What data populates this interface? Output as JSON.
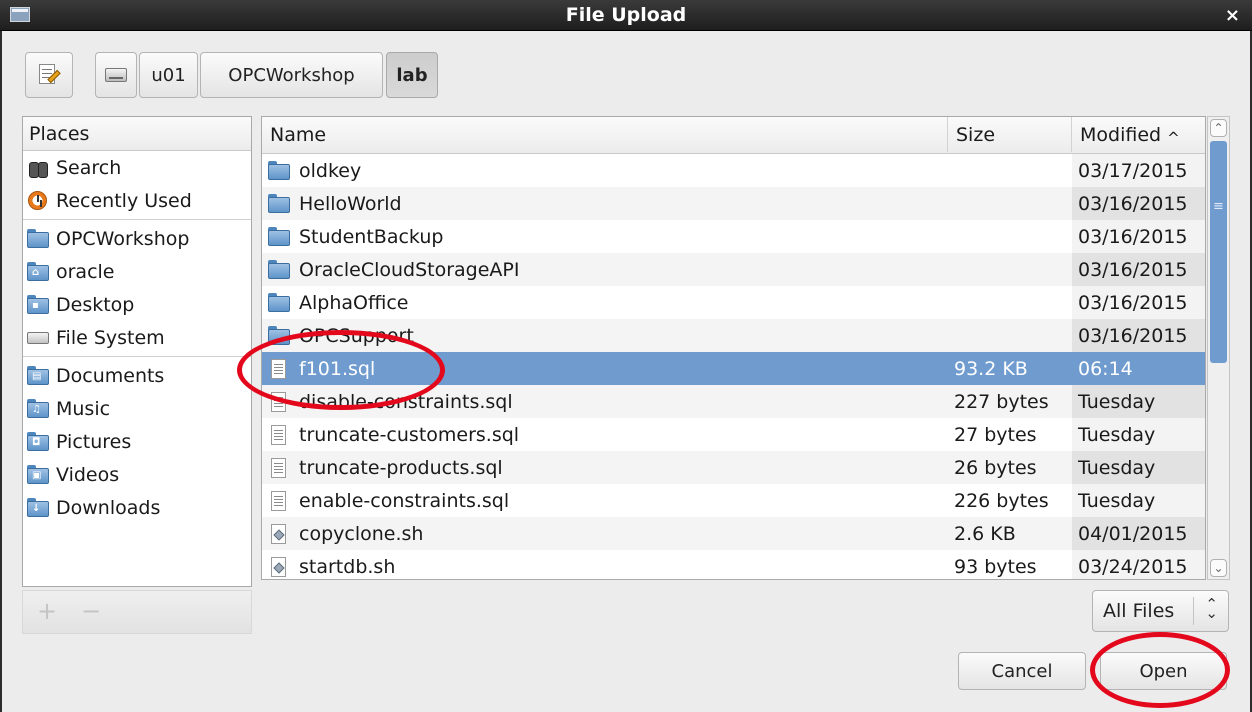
{
  "window": {
    "title": "File Upload",
    "close_glyph": "×"
  },
  "pathbar": {
    "segments": [
      {
        "label": "",
        "icon": "drive-icon",
        "active": false
      },
      {
        "label": "u01",
        "active": false
      },
      {
        "label": "OPCWorkshop",
        "active": false
      },
      {
        "label": "lab",
        "active": true
      }
    ]
  },
  "places": {
    "header": "Places",
    "groups": [
      [
        {
          "label": "Search",
          "icon": "binoculars-icon"
        },
        {
          "label": "Recently Used",
          "icon": "recent-clock-icon"
        }
      ],
      [
        {
          "label": "OPCWorkshop",
          "icon": "folder-icon"
        },
        {
          "label": "oracle",
          "icon": "home-folder-icon"
        },
        {
          "label": "Desktop",
          "icon": "desktop-folder-icon"
        },
        {
          "label": "File System",
          "icon": "drive-icon"
        }
      ],
      [
        {
          "label": "Documents",
          "icon": "documents-folder-icon"
        },
        {
          "label": "Music",
          "icon": "music-folder-icon"
        },
        {
          "label": "Pictures",
          "icon": "pictures-folder-icon"
        },
        {
          "label": "Videos",
          "icon": "videos-folder-icon"
        },
        {
          "label": "Downloads",
          "icon": "downloads-folder-icon"
        }
      ]
    ],
    "add_glyph": "+",
    "remove_glyph": "−"
  },
  "files": {
    "columns": {
      "name": "Name",
      "size": "Size",
      "modified": "Modified",
      "sort_glyph": "^"
    },
    "rows": [
      {
        "name": "oldkey",
        "size": "",
        "modified": "03/17/2015",
        "type": "folder"
      },
      {
        "name": "HelloWorld",
        "size": "",
        "modified": "03/16/2015",
        "type": "folder"
      },
      {
        "name": "StudentBackup",
        "size": "",
        "modified": "03/16/2015",
        "type": "folder"
      },
      {
        "name": "OracleCloudStorageAPI",
        "size": "",
        "modified": "03/16/2015",
        "type": "folder"
      },
      {
        "name": "AlphaOffice",
        "size": "",
        "modified": "03/16/2015",
        "type": "folder"
      },
      {
        "name": "OPCSupport",
        "size": "",
        "modified": "03/16/2015",
        "type": "folder"
      },
      {
        "name": "f101.sql",
        "size": "93.2 KB",
        "modified": "06:14",
        "type": "text",
        "selected": true
      },
      {
        "name": "disable-constraints.sql",
        "size": "227 bytes",
        "modified": "Tuesday",
        "type": "text"
      },
      {
        "name": "truncate-customers.sql",
        "size": "27 bytes",
        "modified": "Tuesday",
        "type": "text"
      },
      {
        "name": "truncate-products.sql",
        "size": "26 bytes",
        "modified": "Tuesday",
        "type": "text"
      },
      {
        "name": "enable-constraints.sql",
        "size": "226 bytes",
        "modified": "Tuesday",
        "type": "text"
      },
      {
        "name": "copyclone.sh",
        "size": "2.6 KB",
        "modified": "04/01/2015",
        "type": "script"
      },
      {
        "name": "startdb.sh",
        "size": "93 bytes",
        "modified": "03/24/2015",
        "type": "script"
      }
    ]
  },
  "filter": {
    "selected": "All Files",
    "glyph": "⌃⌄"
  },
  "actions": {
    "cancel_label": "Cancel",
    "open_label": "Open"
  },
  "colors": {
    "selection": "#6f9bcf",
    "annotation": "#e3081c",
    "titlebar": "#2a2a2a"
  }
}
